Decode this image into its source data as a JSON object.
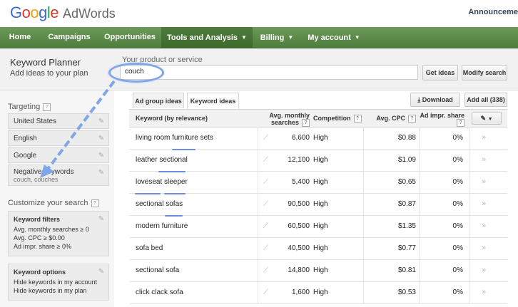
{
  "header": {
    "logo_google": [
      "G",
      "o",
      "o",
      "g",
      "l",
      "e"
    ],
    "logo_product": "AdWords",
    "announcement": "Announceme"
  },
  "nav": [
    {
      "label": "Home",
      "dropdown": false
    },
    {
      "label": "Campaigns",
      "dropdown": false
    },
    {
      "label": "Opportunities",
      "dropdown": false
    },
    {
      "label": "Tools and Analysis",
      "dropdown": true,
      "active": true
    },
    {
      "label": "Billing",
      "dropdown": true
    },
    {
      "label": "My account",
      "dropdown": true
    }
  ],
  "planner": {
    "title": "Keyword Planner",
    "subtitle": "Add ideas to your plan",
    "product_label": "Your product or service",
    "product_value": "couch",
    "get_ideas": "Get ideas",
    "modify_search": "Modify search"
  },
  "sidebar": {
    "targeting_label": "Targeting",
    "targeting_help": "?",
    "location": "United States",
    "language": "English",
    "network": "Google",
    "negative_title": "Negative keywords",
    "negative_values": "couch, couches",
    "customize_label": "Customize your search",
    "customize_help": "?",
    "filters_title": "Keyword filters",
    "filters": [
      "Avg. monthly searches ≥ 0",
      "Avg. CPC ≥ $0.00",
      "Ad impr. share ≥ 0%"
    ],
    "options_title": "Keyword options",
    "options": [
      "Hide keywords in my account",
      "Hide keywords in my plan"
    ]
  },
  "tabs": {
    "ad_group": "Ad group ideas",
    "keyword": "Keyword ideas"
  },
  "actions": {
    "download": "Download",
    "download_icon": "download-icon",
    "add_all": "Add all (338)"
  },
  "table": {
    "headers": {
      "keyword": "Keyword (by relevance)",
      "searches_line1": "Avg. monthly",
      "searches_line2": "searches",
      "competition": "Competition",
      "cpc": "Avg. CPC",
      "impr_line1": "Ad impr. share",
      "help": "?"
    },
    "rows": [
      {
        "keyword": "living room furniture sets",
        "searches": "6,600",
        "competition": "High",
        "cpc": "$0.88",
        "impr": "0%"
      },
      {
        "keyword": "leather sectional",
        "searches": "12,100",
        "competition": "High",
        "cpc": "$1.09",
        "impr": "0%"
      },
      {
        "keyword": "loveseat sleeper",
        "searches": "5,400",
        "competition": "High",
        "cpc": "$0.65",
        "impr": "0%"
      },
      {
        "keyword": "sectional sofas",
        "searches": "90,500",
        "competition": "High",
        "cpc": "$0.87",
        "impr": "0%"
      },
      {
        "keyword": "modern furniture",
        "searches": "60,500",
        "competition": "High",
        "cpc": "$1.35",
        "impr": "0%"
      },
      {
        "keyword": "sofa bed",
        "searches": "40,500",
        "competition": "High",
        "cpc": "$0.77",
        "impr": "0%"
      },
      {
        "keyword": "sectional sofa",
        "searches": "14,800",
        "competition": "High",
        "cpc": "$0.81",
        "impr": "0%"
      },
      {
        "keyword": "click clack sofa",
        "searches": "1,600",
        "competition": "High",
        "cpc": "$0.53",
        "impr": "0%"
      }
    ]
  },
  "colors": {
    "nav_green": "#5d8a4a",
    "annotation_blue": "#7fa6e6"
  }
}
